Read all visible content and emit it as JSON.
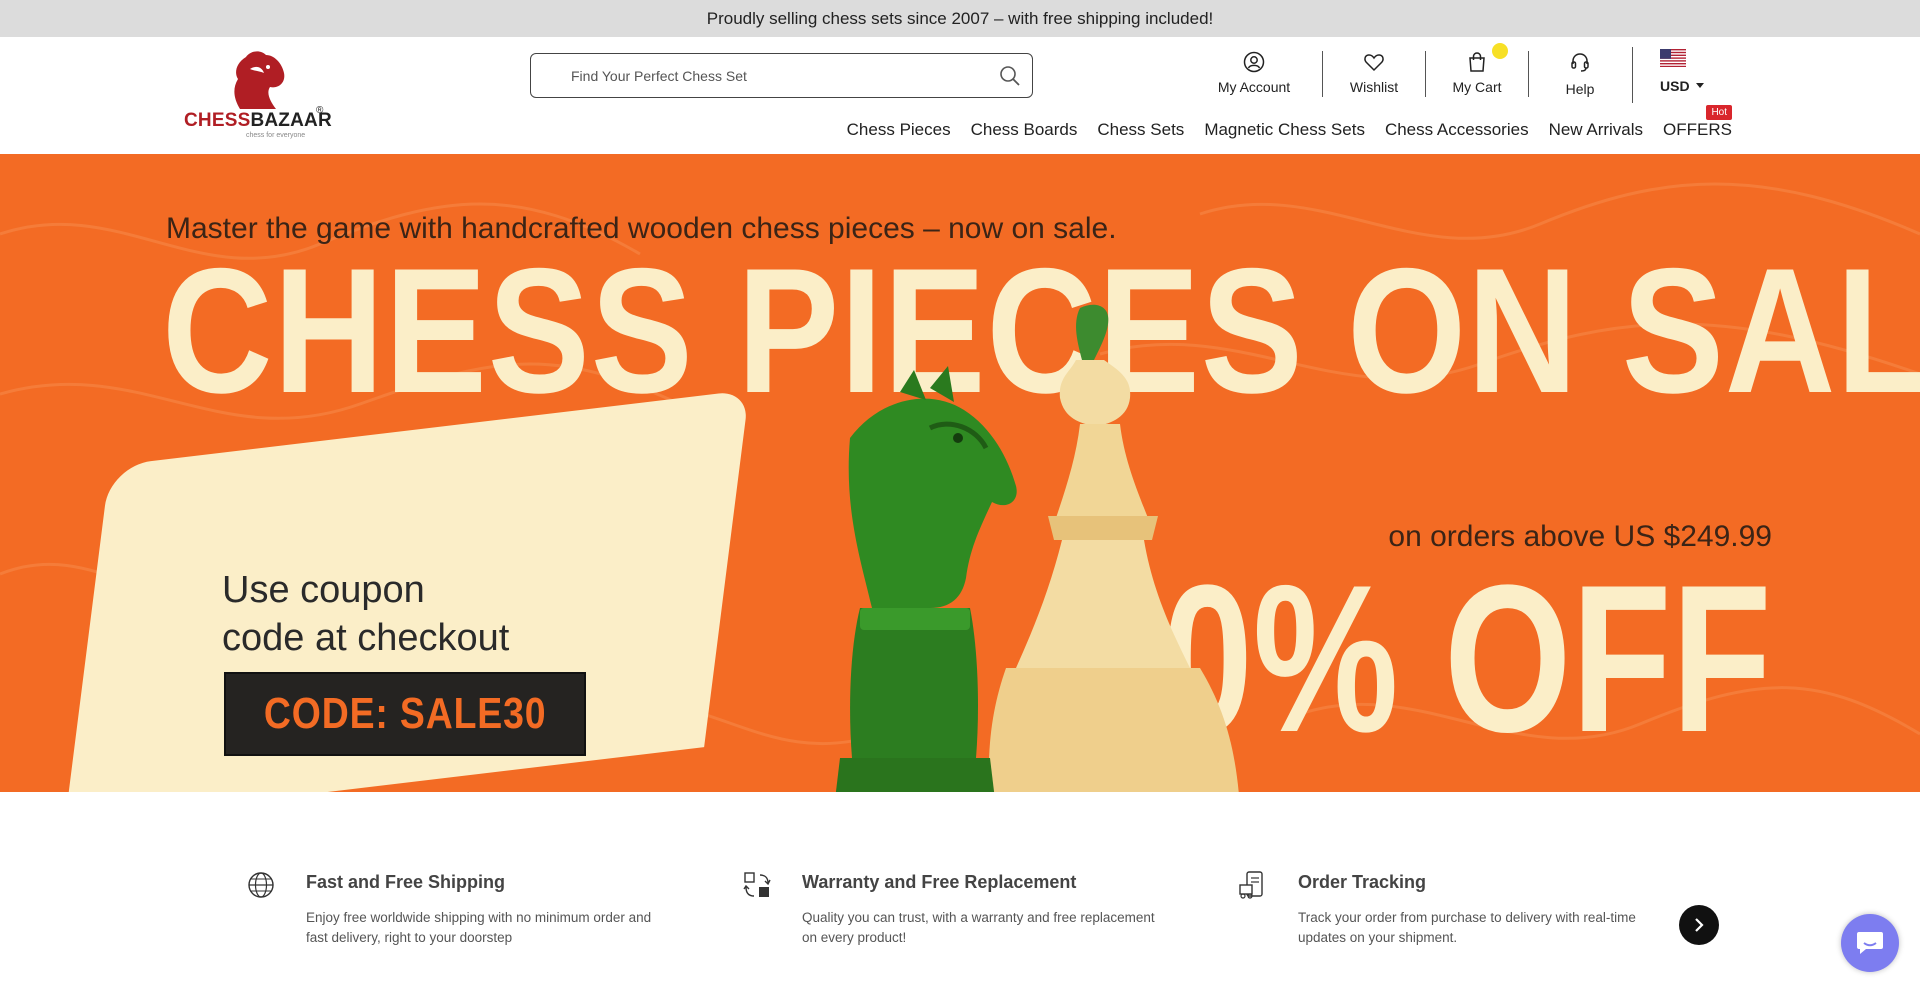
{
  "announcement": {
    "text": "Proudly selling chess sets since 2007 – with free shipping included!"
  },
  "logo": {
    "brand_part1": "CHESS",
    "brand_part2": "BAZAAR",
    "registered": "®",
    "tagline": "chess for everyone"
  },
  "search": {
    "placeholder": "Find Your Perfect Chess Set"
  },
  "header_actions": {
    "account": "My Account",
    "wishlist": "Wishlist",
    "cart": "My Cart",
    "help": "Help"
  },
  "currency": {
    "code": "USD",
    "flag": "us-flag-icon"
  },
  "nav": {
    "items": [
      "Chess Pieces",
      "Chess Boards",
      "Chess Sets",
      "Magnetic Chess Sets",
      "Chess Accessories",
      "New Arrivals",
      "OFFERS"
    ],
    "hot_badge": "Hot"
  },
  "banner": {
    "subtitle": "Master the game with handcrafted wooden chess pieces – now on sale.",
    "headline": "CHESS PIECES ON SALE",
    "orders_text": "on orders above US $249.99",
    "discount": "30% OFF",
    "coupon_line1": "Use coupon",
    "coupon_line2": "code at checkout",
    "code": "CODE: SALE30"
  },
  "features": [
    {
      "icon": "globe-icon",
      "title": "Fast and Free Shipping",
      "desc": "Enjoy free worldwide shipping with no minimum order and fast delivery, right to your doorstep"
    },
    {
      "icon": "replacement-icon",
      "title": "Warranty and Free Replacement",
      "desc": "Quality you can trust, with a warranty and free replacement on every product!"
    },
    {
      "icon": "tracking-icon",
      "title": "Order Tracking",
      "desc": "Track your order from purchase to delivery with real-time updates on your shipment."
    }
  ],
  "colors": {
    "accent": "#f36b24",
    "cream": "#fbeec8",
    "brand_red": "#b01e24",
    "chat": "#7d7df0"
  }
}
